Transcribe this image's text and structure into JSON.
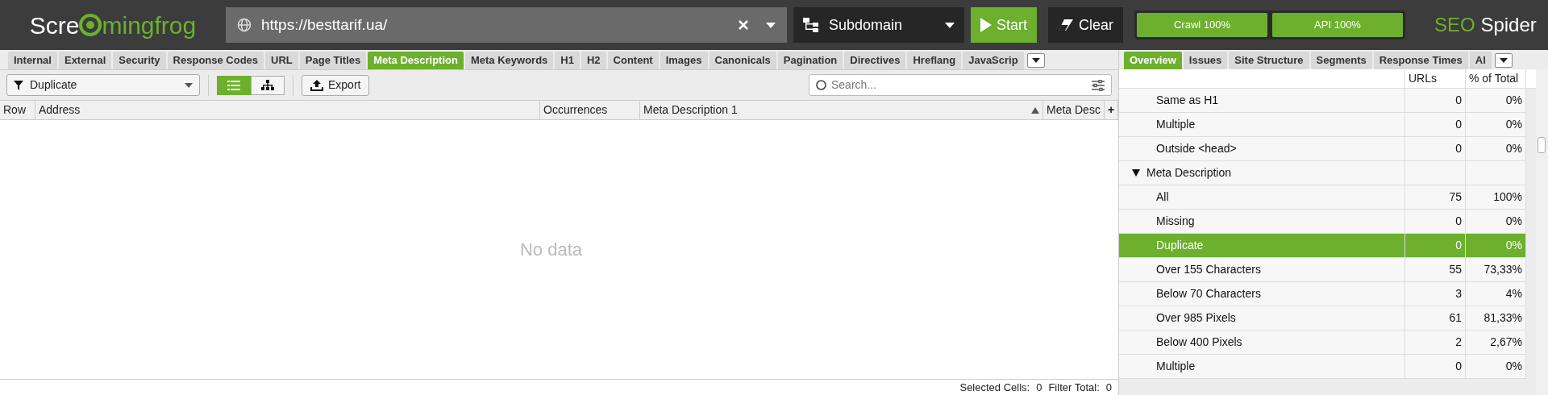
{
  "header": {
    "logo": {
      "left": "Scre",
      "right": "mingfrog"
    },
    "url": "https://besttarif.ua/",
    "scope": "Subdomain",
    "start": "Start",
    "clear": "Clear",
    "progress": [
      {
        "label": "Crawl 100%",
        "level": 1
      },
      {
        "label": "API 100%",
        "level": 1
      }
    ],
    "product": {
      "brand": "SEO",
      "name": "Spider"
    }
  },
  "left_tabs": [
    {
      "label": "Internal",
      "selected": false
    },
    {
      "label": "External",
      "selected": false
    },
    {
      "label": "Security",
      "selected": false
    },
    {
      "label": "Response Codes",
      "selected": false
    },
    {
      "label": "URL",
      "selected": false
    },
    {
      "label": "Page Titles",
      "selected": false
    },
    {
      "label": "Meta Description",
      "selected": true
    },
    {
      "label": "Meta Keywords",
      "selected": false
    },
    {
      "label": "H1",
      "selected": false
    },
    {
      "label": "H2",
      "selected": false
    },
    {
      "label": "Content",
      "selected": false
    },
    {
      "label": "Images",
      "selected": false
    },
    {
      "label": "Canonicals",
      "selected": false
    },
    {
      "label": "Pagination",
      "selected": false
    },
    {
      "label": "Directives",
      "selected": false
    },
    {
      "label": "Hreflang",
      "selected": false
    },
    {
      "label": "JavaScrip",
      "selected": false
    }
  ],
  "toolbar": {
    "filter": "Duplicate",
    "views": [
      {
        "kind": "list",
        "selected": true
      },
      {
        "kind": "tree",
        "selected": false
      }
    ],
    "export": "Export",
    "search": {
      "placeholder": "Search..."
    }
  },
  "table": {
    "columns": [
      {
        "label": "Row"
      },
      {
        "label": "Address"
      },
      {
        "label": "Occurrences"
      },
      {
        "label": "Meta Description 1",
        "sorted": true
      },
      {
        "label": "Meta Desc"
      },
      {
        "label": "+"
      }
    ],
    "empty": "No data"
  },
  "status_bar": {
    "selected_label": "Selected Cells:",
    "selected_value": "0",
    "filter_label": "Filter Total:",
    "filter_value": "0"
  },
  "right_tabs": [
    {
      "label": "Overview",
      "selected": true
    },
    {
      "label": "Issues",
      "selected": false
    },
    {
      "label": "Site Structure",
      "selected": false
    },
    {
      "label": "Segments",
      "selected": false
    },
    {
      "label": "Response Times",
      "selected": false
    },
    {
      "label": "Al",
      "selected": false
    }
  ],
  "overview": {
    "columns": [
      "URLs",
      "% of Total"
    ],
    "rows": [
      {
        "kind": "item",
        "label": "Same as H1",
        "urls": "0",
        "pct": "0%",
        "selected": false
      },
      {
        "kind": "item",
        "label": "Multiple",
        "urls": "0",
        "pct": "0%",
        "selected": false
      },
      {
        "kind": "item",
        "label": "Outside <head>",
        "urls": "0",
        "pct": "0%",
        "selected": false
      },
      {
        "kind": "group",
        "label": "Meta Description",
        "expanded": true,
        "selected": false
      },
      {
        "kind": "item",
        "label": "All",
        "urls": "75",
        "pct": "100%",
        "selected": false
      },
      {
        "kind": "item",
        "label": "Missing",
        "urls": "0",
        "pct": "0%",
        "selected": false
      },
      {
        "kind": "item",
        "label": "Duplicate",
        "urls": "0",
        "pct": "0%",
        "selected": true
      },
      {
        "kind": "item",
        "label": "Over 155 Characters",
        "urls": "55",
        "pct": "73,33%",
        "selected": false
      },
      {
        "kind": "item",
        "label": "Below 70 Characters",
        "urls": "3",
        "pct": "4%",
        "selected": false
      },
      {
        "kind": "item",
        "label": "Over 985 Pixels",
        "urls": "61",
        "pct": "81,33%",
        "selected": false
      },
      {
        "kind": "item",
        "label": "Below 400 Pixels",
        "urls": "2",
        "pct": "2,67%",
        "selected": false
      },
      {
        "kind": "item",
        "label": "Multiple",
        "urls": "0",
        "pct": "0%",
        "selected": false
      }
    ]
  }
}
